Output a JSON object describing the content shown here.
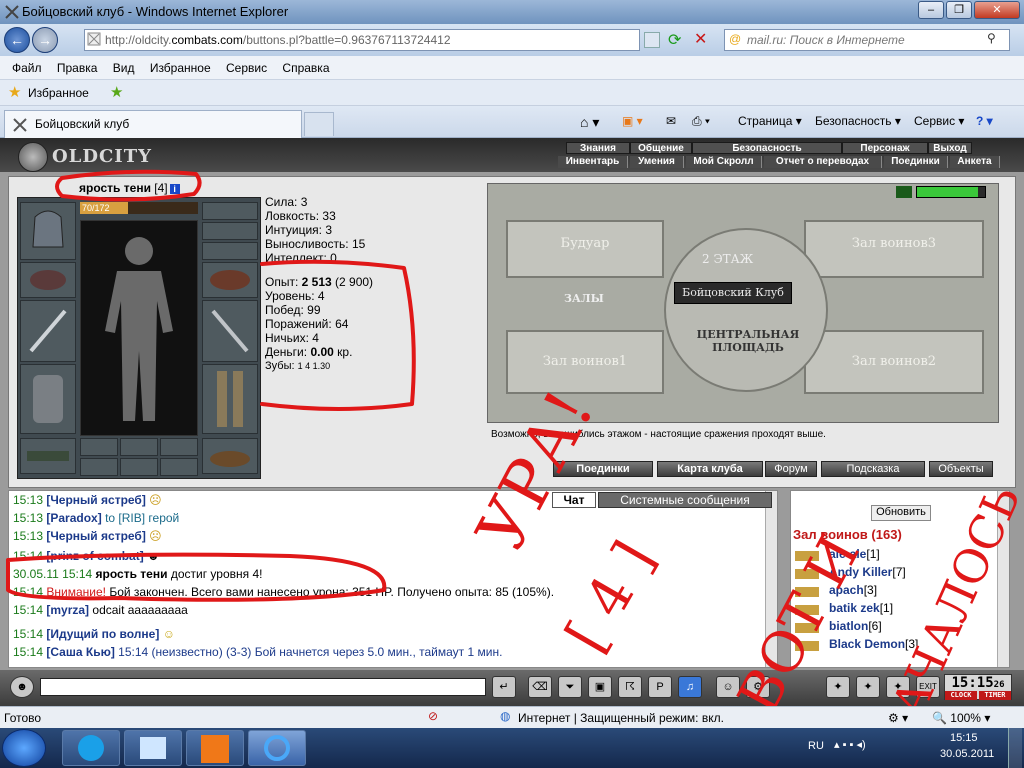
{
  "browser": {
    "title": "Бойцовский клуб - Windows Internet Explorer",
    "url_prefix": "http://",
    "url_host_dim": "oldcity.",
    "url_host": "combats.com",
    "url_path": "/buttons.pl?battle=0.963767113724412",
    "search_placeholder": "mail.ru: Поиск в Интернете",
    "menu": [
      "Файл",
      "Правка",
      "Вид",
      "Избранное",
      "Сервис",
      "Справка"
    ],
    "favorites_label": "Избранное",
    "tab_title": "Бойцовский клуб",
    "cmd_page": "Страница",
    "cmd_security": "Безопасность",
    "cmd_tools": "Сервис",
    "status_ready": "Готово",
    "status_zone": "Интернет | Защищенный режим: вкл.",
    "zoom": "100%"
  },
  "game": {
    "logo": "OLDCITY",
    "nav_top": [
      "Знания",
      "Общение",
      "Безопасность",
      "Персонаж",
      "Выход"
    ],
    "nav_bottom": [
      "Инвентарь",
      "Умения",
      "Мой Скролл",
      "Отчет о переводах",
      "Поединки",
      "Анкета"
    ],
    "character": {
      "name": "ярость тени",
      "level": "[4]",
      "hp_text": "70/172",
      "hp_fraction": 0.41
    },
    "stats": [
      {
        "label": "Сила:",
        "value": "3"
      },
      {
        "label": "Ловкость:",
        "value": "33"
      },
      {
        "label": "Интуиция:",
        "value": "3"
      },
      {
        "label": "Выносливость:",
        "value": "15"
      },
      {
        "label": "Интеллект:",
        "value": "0"
      }
    ],
    "progress": [
      {
        "label": "Опыт:",
        "value": "2 513",
        "extra": "(2 900)"
      },
      {
        "label": "Уровень:",
        "value": "4",
        "extra": ""
      },
      {
        "label": "Побед:",
        "value": "99",
        "extra": ""
      },
      {
        "label": "Поражений:",
        "value": "64",
        "extra": ""
      },
      {
        "label": "Ничьих:",
        "value": "4",
        "extra": ""
      },
      {
        "label": "Деньги:",
        "value": "0.00",
        "extra": "кр."
      }
    ],
    "teeth_label": "Зубы:",
    "teeth_values": "1  4  1.30",
    "map": {
      "floor": "2 ЭТАЖ",
      "club": "Бойцовский Клуб",
      "halls": "ЗАЛЫ",
      "square": "ЦЕНТРАЛЬНАЯ ПЛОЩАДЬ",
      "room_boudoir": "Будуар",
      "room_w3": "Зал воинов3",
      "room_w1": "Зал воинов1",
      "room_w2": "Зал воинов2",
      "caption": "Возможно, вы ошиблись этажом - настоящие сражения проходят выше."
    },
    "buttons": [
      "Поединки",
      "Карта клуба",
      "Форум",
      "Подсказка",
      "Объекты"
    ],
    "chat_tabs": [
      "Чат",
      "Системные сообщения"
    ],
    "chat": [
      {
        "time": "15:13",
        "nick": "[Черный ястреб]",
        "text": "",
        "emote": "frown"
      },
      {
        "time": "15:13",
        "nick": "[Paradox]",
        "text": " to [RIB] герой",
        "emote": ""
      },
      {
        "time": "15:13",
        "nick": "[Черный ястреб]",
        "text": "",
        "emote": "frown"
      },
      {
        "time": "15:14",
        "nick": "[prinz of combat]",
        "text": "",
        "emote": ""
      },
      {
        "time": "30.05.11 15:14",
        "nick": "ярость тени",
        "text": " достиг уровня 4!",
        "emote": ""
      },
      {
        "time": "15:14",
        "nick": "",
        "warn": "Внимание!",
        "text": " Бой закончен. Всего вами нанесено урона: 351 HP. Получено опыта: 85 (105%).",
        "emote": ""
      },
      {
        "time": "15:14",
        "nick": "[myrza]",
        "text": " odcait aaaaaaaaa",
        "emote": ""
      },
      {
        "time": "15:14",
        "nick": "[Идущий по волне]",
        "text": "",
        "emote": "smile"
      },
      {
        "time": "15:14",
        "nick": "[Саша Кью]",
        "text": " 15:14 (неизвестно) (3-3) Бой начнется через 5.0 мин., таймаут 1 мин.",
        "emote": ""
      }
    ],
    "refresh_label": "Обновить",
    "room_label": "Зал воинов",
    "room_count": "(163)",
    "users": [
      {
        "name": "ale-ale",
        "lvl": "[1]"
      },
      {
        "name": "Andy Killer",
        "lvl": "[7]"
      },
      {
        "name": "apach",
        "lvl": "[3]"
      },
      {
        "name": "batik zek",
        "lvl": "[1]"
      },
      {
        "name": "biatlon",
        "lvl": "[6]"
      },
      {
        "name": "Black Demon",
        "lvl": "[3]"
      }
    ],
    "clock": "15:15",
    "clock_sec": "26",
    "clock_label": "CLOCK",
    "timer_label": "TIMER"
  },
  "overlay_text": [
    "УРА!",
    "[ 4 ]",
    "ВОТ И",
    "НАЧАЛОСЬ"
  ],
  "taskbar": {
    "lang": "RU",
    "time": "15:15",
    "date": "30.05.2011"
  },
  "colors": {
    "accent_red": "#e01818",
    "link_blue": "#1c3a8a",
    "time_green": "#1a7a1a"
  }
}
